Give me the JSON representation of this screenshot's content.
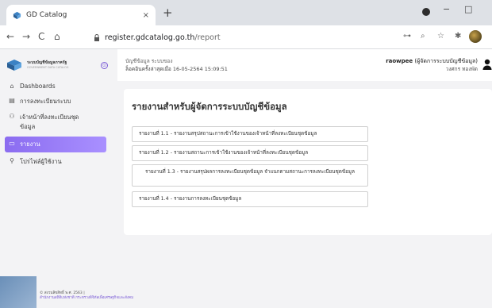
{
  "browser": {
    "tab_title": "GD Catalog",
    "tab_close": "×",
    "new_tab": "+",
    "url_host": "register.gdcatalog.go.th",
    "url_path": "/report",
    "back": "←",
    "forward": "→",
    "reload": "C",
    "home": "⌂",
    "minimize": "−",
    "maximize": "□",
    "key_icon": "⊶",
    "zoom_icon": "⌕",
    "star_icon": "☆",
    "puzzle_icon": "✱"
  },
  "sidebar": {
    "brand_line1": "ระบบบัญชีข้อมูลภาครัฐ",
    "brand_line2": "GOVERNMENT DATA CATALOG",
    "items": [
      {
        "label": "Dashboards",
        "icon": "⌂"
      },
      {
        "label": "การลงทะเบียนระบบ",
        "icon": "▤"
      },
      {
        "label": "เจ้าหน้าที่ลงทะเบียนชุดข้อมูล",
        "icon": "⚇"
      },
      {
        "label": "รายงาน",
        "icon": "▭"
      },
      {
        "label": "โปรไฟล์ผู้ใช้งาน",
        "icon": "⚲"
      }
    ],
    "footer_copyright": "© สงวนลิขสิทธิ์ พ.ศ. 2563 |",
    "footer_org": "สำนักงานสถิติแห่งชาติ กระทรวงดิจิทัลเพื่อเศรษฐกิจและสังคม"
  },
  "header": {
    "system_name": "บัญชีข้อมูล ระบบของ",
    "last_login": "ล็อคอินครั้งล่าสุดเมื่อ 16-05-2564 15:09:51",
    "user_name": "raowpee",
    "user_role": "(ผู้จัดการระบบบัญชีข้อมูล)",
    "user_org": "วงศกร ทองพัด"
  },
  "page": {
    "title": "รายงานสำหรับผู้จัดการระบบบัญชีข้อมูล",
    "reports": [
      "รายงานที่ 1.1 - รายงานสรุปสถานะการเข้าใช้งานของเจ้าหน้าที่ลงทะเบียนชุดข้อมูล",
      "รายงานที่ 1.2 - รายงานสถานะการเข้าใช้งานของเจ้าหน้าที่ลงทะเบียนชุดข้อมูล",
      "รายงานที่ 1.3 - รายงานสรุปผลการลงทะเบียนชุดข้อมูล จำแนกตามสถานะการลงทะเบียนชุดข้อมูล",
      "รายงานที่ 1.4 - รายงานการลงทะเบียนชุดข้อมูล"
    ]
  },
  "colors": {
    "accent": "#8b6cf0",
    "sidebar_bg": "#f3f3f5"
  }
}
